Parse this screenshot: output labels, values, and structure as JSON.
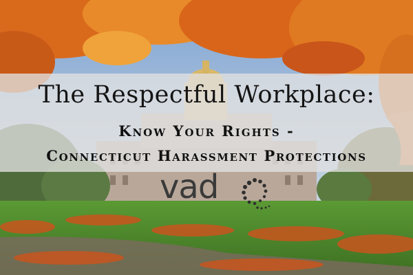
{
  "hero": {
    "title": "The Respectful Workplace:",
    "subtitle_line1": "Know Your Rights -",
    "subtitle_line2": "Connecticut Harassment Protections"
  },
  "logo": {
    "text": "vad",
    "color": "#3a3a3a"
  },
  "colors": {
    "sky": "#8fb3d9",
    "foliage_orange": "#e0731f",
    "lawn_green": "#4f8a2e",
    "banner": "#e1e1e1"
  }
}
